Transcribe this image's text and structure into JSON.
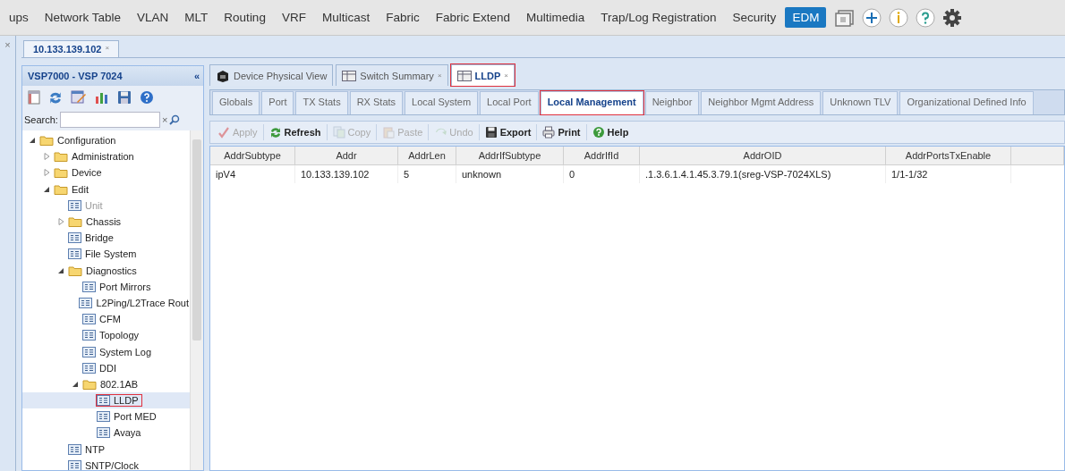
{
  "menu_bar": {
    "items": [
      {
        "label": "ups",
        "selected": false
      },
      {
        "label": "Network Table",
        "selected": false
      },
      {
        "label": "VLAN",
        "selected": false
      },
      {
        "label": "MLT",
        "selected": false
      },
      {
        "label": "Routing",
        "selected": false
      },
      {
        "label": "VRF",
        "selected": false
      },
      {
        "label": "Multicast",
        "selected": false
      },
      {
        "label": "Fabric",
        "selected": false
      },
      {
        "label": "Fabric Extend",
        "selected": false
      },
      {
        "label": "Multimedia",
        "selected": false
      },
      {
        "label": "Trap/Log Registration",
        "selected": false
      },
      {
        "label": "Security",
        "selected": false
      },
      {
        "label": "EDM",
        "selected": true
      }
    ]
  },
  "device_tab": {
    "label": "10.133.139.102",
    "close": "×"
  },
  "left_strip": {
    "close": "×"
  },
  "sidebar": {
    "title": "VSP7000 - VSP 7024",
    "collapse": "«",
    "search": {
      "label": "Search:",
      "clear": "×"
    },
    "tree": [
      {
        "label": "Configuration",
        "kind": "folder",
        "expanded": true,
        "children": [
          {
            "label": "Administration",
            "kind": "folder",
            "expanded": false
          },
          {
            "label": "Device",
            "kind": "folder",
            "expanded": false
          },
          {
            "label": "Edit",
            "kind": "folder",
            "expanded": true,
            "children": [
              {
                "label": "Unit",
                "kind": "leaf",
                "disabled": true
              },
              {
                "label": "Chassis",
                "kind": "folder",
                "expanded": false
              },
              {
                "label": "Bridge",
                "kind": "leaf",
                "disabled": false
              },
              {
                "label": "File System",
                "kind": "leaf",
                "disabled": false
              },
              {
                "label": "Diagnostics",
                "kind": "folder",
                "expanded": true,
                "children": [
                  {
                    "label": "Port Mirrors",
                    "kind": "leaf",
                    "disabled": false
                  },
                  {
                    "label": "L2Ping/L2Trace Rout",
                    "kind": "leaf",
                    "disabled": false
                  },
                  {
                    "label": "CFM",
                    "kind": "leaf",
                    "disabled": false
                  },
                  {
                    "label": "Topology",
                    "kind": "leaf",
                    "disabled": false
                  },
                  {
                    "label": "System Log",
                    "kind": "leaf",
                    "disabled": false
                  },
                  {
                    "label": "DDI",
                    "kind": "leaf",
                    "disabled": false
                  },
                  {
                    "label": "802.1AB",
                    "kind": "folder",
                    "expanded": true,
                    "children": [
                      {
                        "label": "LLDP",
                        "kind": "leaf",
                        "disabled": false,
                        "selected": true,
                        "highlighted": true
                      },
                      {
                        "label": "Port MED",
                        "kind": "leaf",
                        "disabled": false,
                        "selected": false,
                        "highlighted": false
                      },
                      {
                        "label": "Avaya",
                        "kind": "leaf",
                        "disabled": false,
                        "selected": false,
                        "highlighted": false
                      }
                    ]
                  }
                ]
              },
              {
                "label": "NTP",
                "kind": "leaf",
                "disabled": false
              },
              {
                "label": "SNTP/Clock",
                "kind": "leaf",
                "disabled": false
              }
            ]
          }
        ]
      }
    ]
  },
  "view_tabs": [
    {
      "label": "Device Physical View",
      "kind": "device",
      "close": false,
      "selected": false,
      "highlighted": false
    },
    {
      "label": "Switch Summary",
      "kind": "table",
      "close": true,
      "selected": false,
      "highlighted": false
    },
    {
      "label": "LLDP",
      "kind": "table",
      "close": true,
      "selected": true,
      "highlighted": true
    }
  ],
  "tab_close": "×",
  "sub_tabs": [
    {
      "label": "Globals",
      "selected": false,
      "highlighted": false
    },
    {
      "label": "Port",
      "selected": false,
      "highlighted": false
    },
    {
      "label": "TX Stats",
      "selected": false,
      "highlighted": false
    },
    {
      "label": "RX Stats",
      "selected": false,
      "highlighted": false
    },
    {
      "label": "Local System",
      "selected": false,
      "highlighted": false
    },
    {
      "label": "Local Port",
      "selected": false,
      "highlighted": false
    },
    {
      "label": "Local Management",
      "selected": true,
      "highlighted": true
    },
    {
      "label": "Neighbor",
      "selected": false,
      "highlighted": false
    },
    {
      "label": "Neighbor Mgmt Address",
      "selected": false,
      "highlighted": false
    },
    {
      "label": "Unknown TLV",
      "selected": false,
      "highlighted": false
    },
    {
      "label": "Organizational Defined Info",
      "selected": false,
      "highlighted": false
    }
  ],
  "toolbar": [
    {
      "label": "Apply",
      "kind": "apply",
      "disabled": true
    },
    {
      "label": "Refresh",
      "kind": "refresh",
      "disabled": false
    },
    {
      "label": "Copy",
      "kind": "copy",
      "disabled": true
    },
    {
      "label": "Paste",
      "kind": "paste",
      "disabled": true
    },
    {
      "label": "Undo",
      "kind": "undo",
      "disabled": true
    },
    {
      "label": "Export",
      "kind": "export",
      "disabled": false
    },
    {
      "label": "Print",
      "kind": "print",
      "disabled": false
    },
    {
      "label": "Help",
      "kind": "help",
      "disabled": false
    }
  ],
  "table": {
    "columns": [
      "AddrSubtype",
      "Addr",
      "AddrLen",
      "AddrIfSubtype",
      "AddrIfId",
      "AddrOID",
      "AddrPortsTxEnable"
    ],
    "rows": [
      [
        "ipV4",
        "10.133.139.102",
        "5",
        "unknown",
        "0",
        ".1.3.6.1.4.1.45.3.79.1(sreg-VSP-7024XLS)",
        "1/1-1/32"
      ]
    ]
  }
}
